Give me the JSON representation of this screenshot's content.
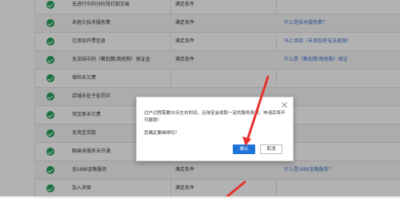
{
  "table": {
    "rows": [
      {
        "name": "无进行中的分阶段打款交易",
        "status": "满足条件",
        "extra": "-",
        "extra_type": "dash"
      },
      {
        "name": "未拖欠技术服务费",
        "status": "满足条件",
        "extra": "什么是技术服务费？",
        "extra_type": "link"
      },
      {
        "name": "已添加开票信息",
        "status": "满足条件",
        "extra": "马上添加（未添加将无法退保）",
        "extra_type": "link"
      },
      {
        "name": "无流结中的（聚划算/淘抢购）保证金",
        "status": "满足条件",
        "extra": "什么是（聚划算/淘抢购）保证",
        "extra_type": "link"
      },
      {
        "name": "保险未欠费",
        "status": "",
        "extra": "",
        "extra_type": "none"
      },
      {
        "name": "店铺未处于处罚中",
        "status": "",
        "extra": "",
        "extra_type": "none"
      },
      {
        "name": "淘宝客未欠费",
        "status": "",
        "extra": "",
        "extra_type": "none"
      },
      {
        "name": "无淘宝贷款",
        "status": "",
        "extra": "",
        "extra_type": "none"
      },
      {
        "name": "融易收服务未开通",
        "status": "",
        "extra": "",
        "extra_type": "none"
      },
      {
        "name": "无1688金融服务",
        "status": "满足条件",
        "extra": "什么是1688金融服务？",
        "extra_type": "link"
      },
      {
        "name": "加入消保",
        "status": "满足条件",
        "extra": "-",
        "extra_type": "dash"
      }
    ]
  },
  "dialog": {
    "message": "过户过程需要20天左右时间，且淘宝会收取一定的服务费用，申请后将不可撤销！",
    "question": "您确定要继续吗？",
    "confirm_label": "确认",
    "cancel_label": "取消"
  },
  "colors": {
    "success": "#23a35a",
    "link": "#3b73d1",
    "primary_button": "#1d73d8",
    "annotation_arrow": "#e8322e"
  }
}
